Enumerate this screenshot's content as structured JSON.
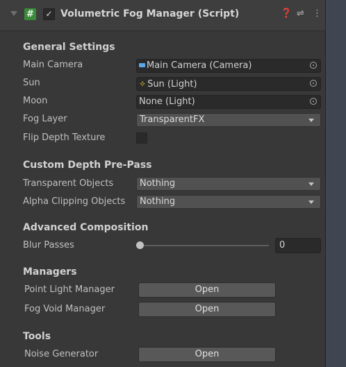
{
  "header": {
    "script_icon": "#",
    "enabled_check": "✓",
    "title": "Volumetric Fog Manager (Script)",
    "help_icon": "❓",
    "preset_icon": "⇌",
    "menu_icon": "⋮"
  },
  "general": {
    "title": "General Settings",
    "main_camera_label": "Main Camera",
    "main_camera_value": "Main Camera (Camera)",
    "main_camera_icon": "camera-icon",
    "sun_label": "Sun",
    "sun_value": "Sun (Light)",
    "sun_icon": "light-icon",
    "moon_label": "Moon",
    "moon_value": "None (Light)",
    "fog_layer_label": "Fog Layer",
    "fog_layer_value": "TransparentFX",
    "flip_label": "Flip Depth Texture",
    "flip_checked": false
  },
  "prepass": {
    "title": "Custom Depth Pre-Pass",
    "transparent_label": "Transparent Objects",
    "transparent_value": "Nothing",
    "alpha_label": "Alpha Clipping Objects",
    "alpha_value": "Nothing"
  },
  "composition": {
    "title": "Advanced Composition",
    "blur_label": "Blur Passes",
    "blur_value": "0"
  },
  "managers": {
    "title": "Managers",
    "point_light_label": "Point Light Manager",
    "point_light_button": "Open",
    "fog_void_label": "Fog Void Manager",
    "fog_void_button": "Open"
  },
  "tools": {
    "title": "Tools",
    "noise_label": "Noise Generator",
    "noise_button": "Open"
  },
  "colors": {
    "background": "#383838",
    "field": "#2a2a2a",
    "button": "#585858",
    "script_icon": "#3b8a3b"
  }
}
